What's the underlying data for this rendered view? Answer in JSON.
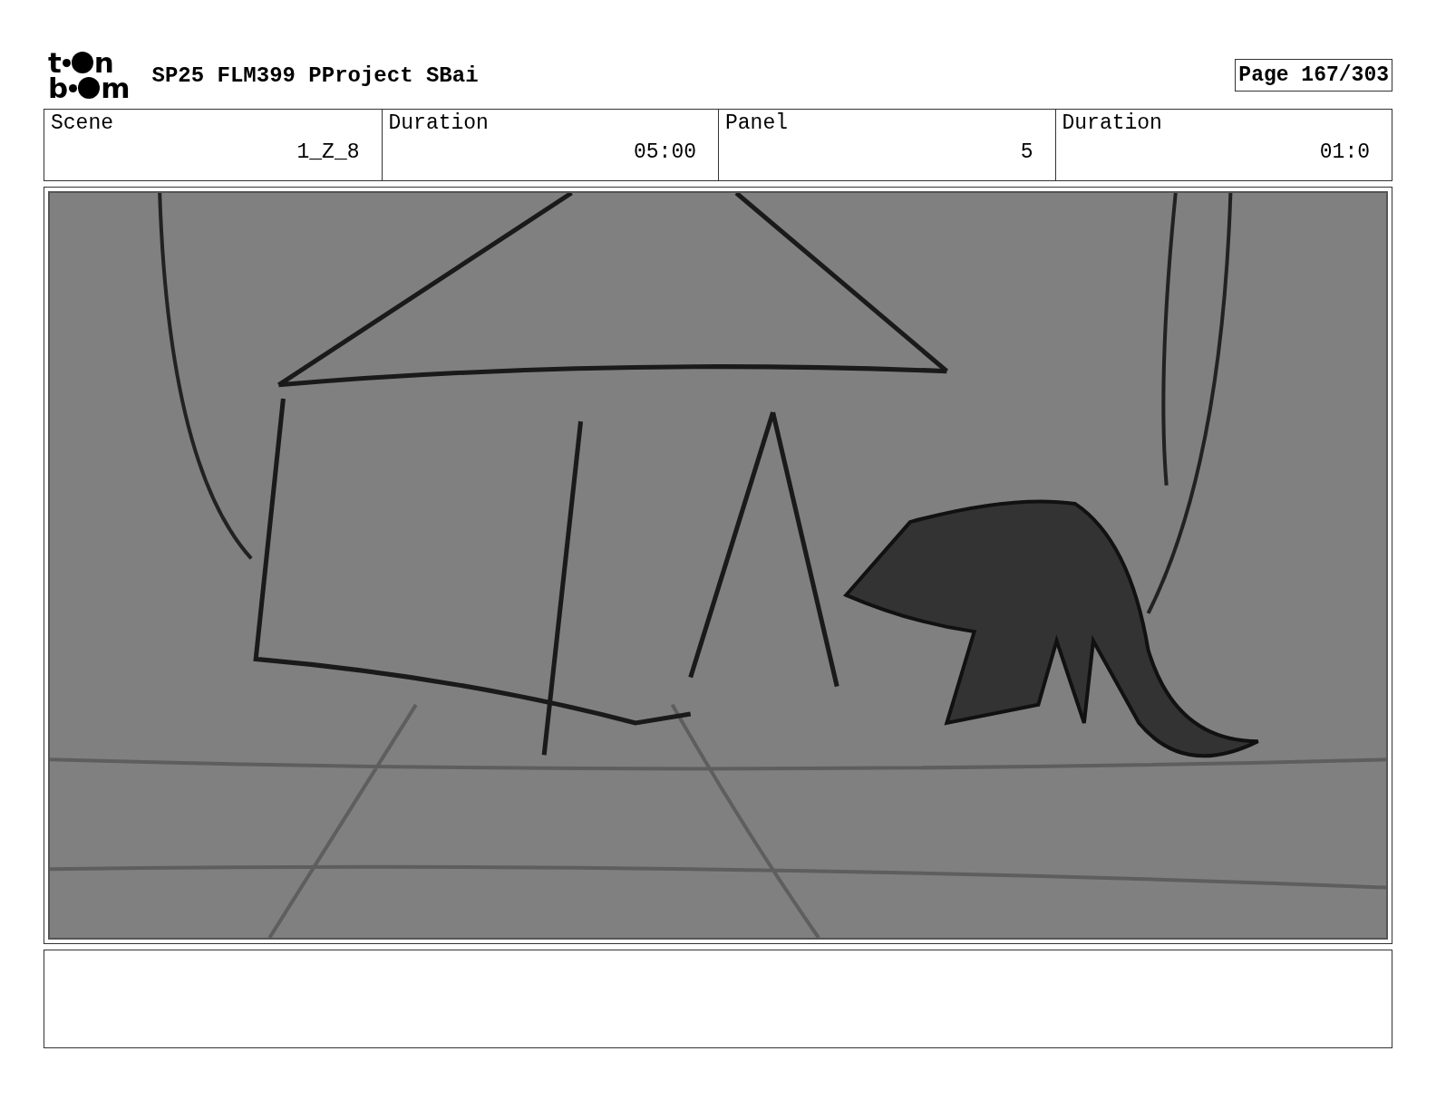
{
  "logo": [
    {
      "before": "t",
      "after": "n"
    },
    {
      "before": "b",
      "after": "m"
    }
  ],
  "title": "SP25 FLM399 PProject SBai",
  "page": "Page 167/303",
  "fields": [
    {
      "label": "Scene",
      "value": "1_Z_8"
    },
    {
      "label": "Duration",
      "value": "05:00"
    },
    {
      "label": "Panel",
      "value": "5"
    },
    {
      "label": "Duration",
      "value": "01:0"
    }
  ]
}
